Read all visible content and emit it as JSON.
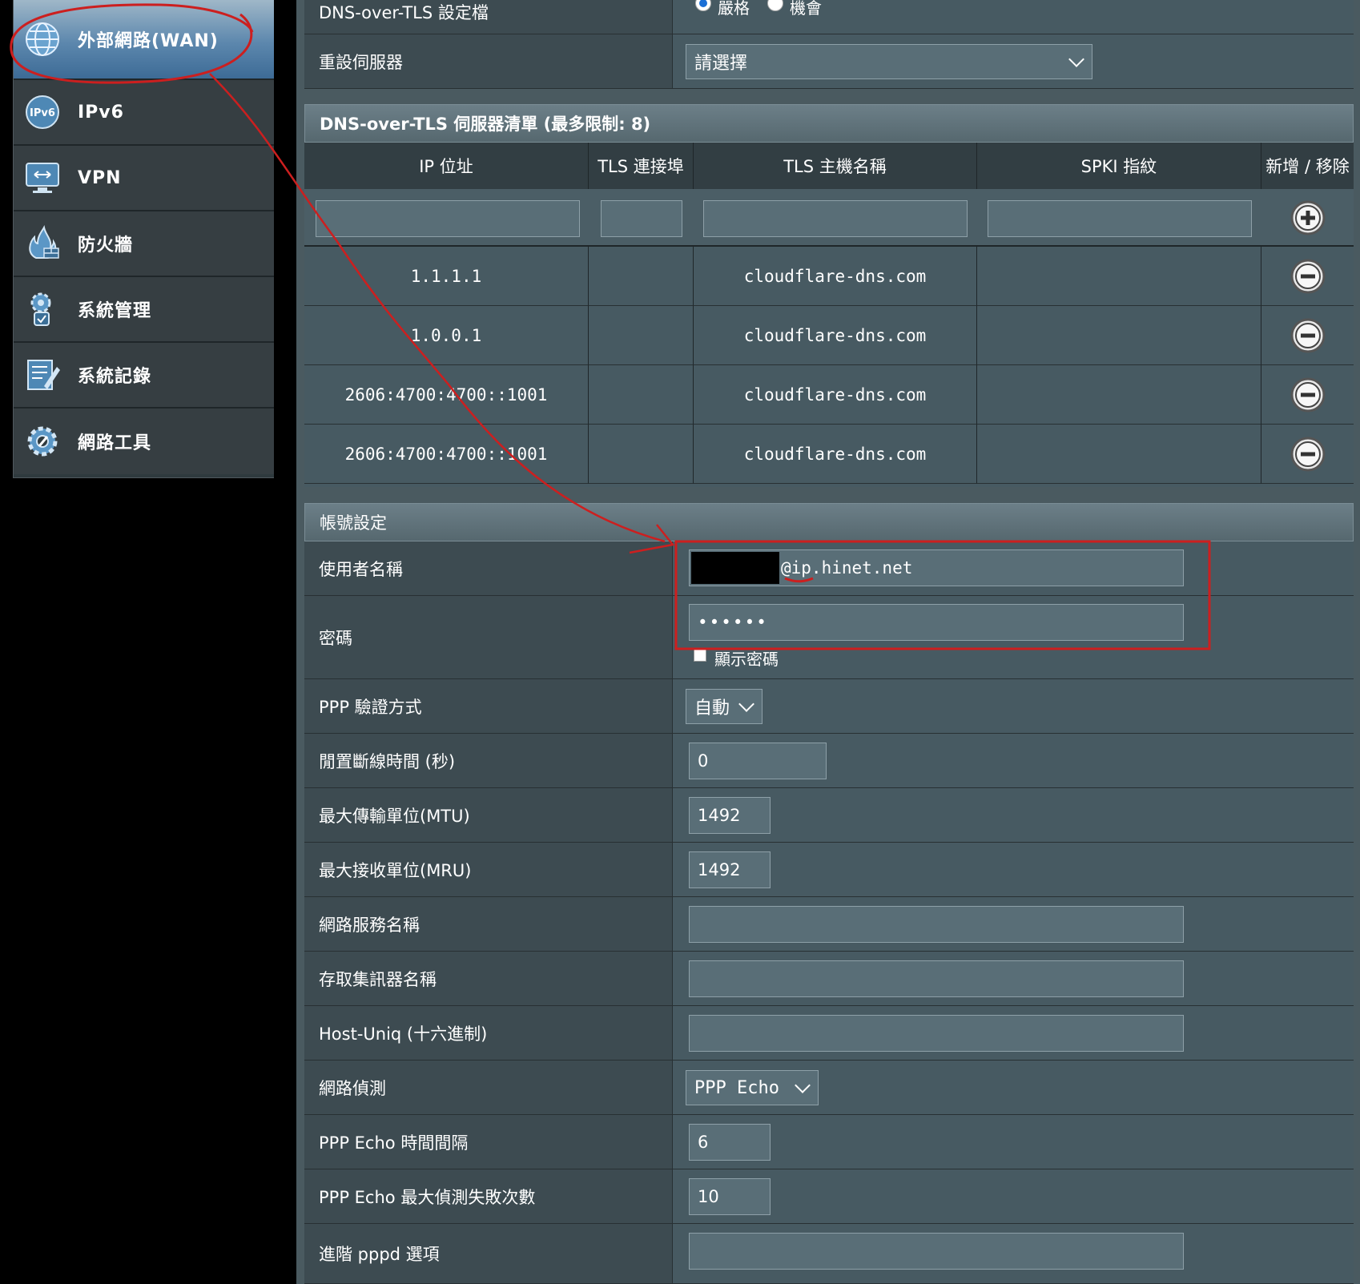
{
  "sidebar": {
    "items": [
      {
        "label": "外部網路(WAN)",
        "icon": "globe-icon"
      },
      {
        "label": "IPv6",
        "icon": "ipv6-icon"
      },
      {
        "label": "VPN",
        "icon": "monitor-icon"
      },
      {
        "label": "防火牆",
        "icon": "firewall-icon"
      },
      {
        "label": "系統管理",
        "icon": "admin-gear-icon"
      },
      {
        "label": "系統記錄",
        "icon": "log-icon"
      },
      {
        "label": "網路工具",
        "icon": "tools-gear-icon"
      }
    ]
  },
  "dot_profile": {
    "label": "DNS-over-TLS 設定檔",
    "options": [
      "嚴格",
      "機會"
    ]
  },
  "reset_server": {
    "label": "重設伺服器",
    "select_value": "請選擇"
  },
  "dns_table": {
    "title": "DNS-over-TLS 伺服器清單 (最多限制: 8)",
    "headers": [
      "IP 位址",
      "TLS 連接埠",
      "TLS 主機名稱",
      "SPKI 指紋",
      "新增 / 移除"
    ],
    "rows": [
      {
        "ip": "1.1.1.1",
        "port": "",
        "host": "cloudflare-dns.com",
        "spki": ""
      },
      {
        "ip": "1.0.0.1",
        "port": "",
        "host": "cloudflare-dns.com",
        "spki": ""
      },
      {
        "ip": "2606:4700:4700::1001",
        "port": "",
        "host": "cloudflare-dns.com",
        "spki": ""
      },
      {
        "ip": "2606:4700:4700::1001",
        "port": "",
        "host": "cloudflare-dns.com",
        "spki": ""
      }
    ]
  },
  "account": {
    "title": "帳號設定",
    "username_label": "使用者名稱",
    "username_value": "@ip.hinet.net",
    "password_label": "密碼",
    "password_value": "••••••",
    "show_password_label": "顯示密碼",
    "ppp_auth_label": "PPP 驗證方式",
    "ppp_auth_value": "自動",
    "idle_label": "閒置斷線時間 (秒)",
    "idle_value": "0",
    "mtu_label": "最大傳輸單位(MTU)",
    "mtu_value": "1492",
    "mru_label": "最大接收單位(MRU)",
    "mru_value": "1492",
    "service_label": "網路服務名稱",
    "service_value": "",
    "ac_label": "存取集訊器名稱",
    "ac_value": "",
    "hostuniq_label": "Host-Uniq (十六進制)",
    "hostuniq_value": "",
    "detect_label": "網路偵測",
    "detect_value": "PPP Echo",
    "echo_interval_label": "PPP Echo 時間間隔",
    "echo_interval_value": "6",
    "echo_fail_label": "PPP Echo 最大偵測失敗次數",
    "echo_fail_value": "10",
    "pppd_label": "進階 pppd 選項",
    "pppd_value": ""
  },
  "colors": {
    "annotation_red": "#cc1f1f",
    "panel": "#475a62",
    "label_cell": "#3d4b51"
  }
}
